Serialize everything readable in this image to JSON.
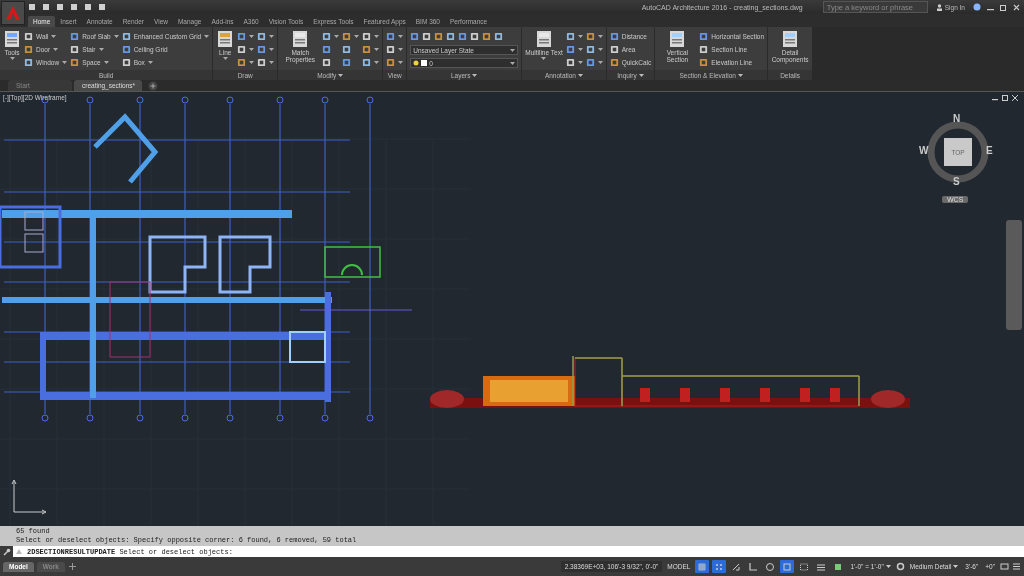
{
  "title_bar": {
    "title": "AutoCAD Architecture 2016 - creating_sections.dwg",
    "search_placeholder": "Type a keyword or phrase",
    "sign_in": "Sign In"
  },
  "ribbon_tabs": [
    {
      "label": "Home",
      "selected": true
    },
    {
      "label": "Insert",
      "selected": false
    },
    {
      "label": "Annotate",
      "selected": false
    },
    {
      "label": "Render",
      "selected": false
    },
    {
      "label": "View",
      "selected": false
    },
    {
      "label": "Manage",
      "selected": false
    },
    {
      "label": "Add-ins",
      "selected": false
    },
    {
      "label": "A360",
      "selected": false
    },
    {
      "label": "Vision Tools",
      "selected": false
    },
    {
      "label": "Express Tools",
      "selected": false
    },
    {
      "label": "Featured Apps",
      "selected": false
    },
    {
      "label": "BIM 360",
      "selected": false
    },
    {
      "label": "Performance",
      "selected": false
    }
  ],
  "ribbon_panels": [
    {
      "title": "Build",
      "menu": false,
      "columns": [
        [
          {
            "kind": "large",
            "label": "Tools",
            "menu": true
          }
        ],
        [
          {
            "kind": "small",
            "label": "Wall",
            "menu": true
          },
          {
            "kind": "small",
            "label": "Door",
            "menu": true
          },
          {
            "kind": "small",
            "label": "Window",
            "menu": true
          }
        ],
        [
          {
            "kind": "small",
            "label": "Roof Slab",
            "menu": true
          },
          {
            "kind": "small",
            "label": "Stair",
            "menu": true
          },
          {
            "kind": "small",
            "label": "Space",
            "menu": true
          }
        ],
        [
          {
            "kind": "small",
            "label": "Enhanced Custom Grid",
            "menu": true
          },
          {
            "kind": "small",
            "label": "Ceiling Grid",
            "menu": false
          },
          {
            "kind": "small",
            "label": "Box",
            "menu": true
          }
        ]
      ]
    },
    {
      "title": "Draw",
      "menu": false,
      "columns": [
        [
          {
            "kind": "large",
            "label": "Line",
            "menu": true
          }
        ],
        [
          {
            "kind": "icon",
            "menu": true
          },
          {
            "kind": "icon",
            "menu": true
          },
          {
            "kind": "icon",
            "menu": true
          }
        ],
        [
          {
            "kind": "icon",
            "menu": true
          },
          {
            "kind": "icon",
            "menu": true
          },
          {
            "kind": "icon",
            "menu": true
          }
        ]
      ]
    },
    {
      "title": "Modify",
      "menu": true,
      "columns": [
        [
          {
            "kind": "large",
            "label": "Match Properties",
            "menu": false
          }
        ],
        [
          {
            "kind": "icon",
            "menu": true
          },
          {
            "kind": "icon",
            "menu": false
          },
          {
            "kind": "icon",
            "menu": false
          }
        ],
        [
          {
            "kind": "icon",
            "menu": true
          },
          {
            "kind": "icon",
            "menu": false
          },
          {
            "kind": "icon",
            "menu": false
          }
        ],
        [
          {
            "kind": "icon",
            "menu": true
          },
          {
            "kind": "icon",
            "menu": true
          },
          {
            "kind": "icon",
            "menu": true
          }
        ]
      ]
    },
    {
      "title": "View",
      "menu": false,
      "columns": [
        [
          {
            "kind": "icon",
            "menu": true
          },
          {
            "kind": "icon",
            "menu": true
          },
          {
            "kind": "icon",
            "menu": true
          }
        ]
      ]
    },
    {
      "title": "Layers",
      "menu": true,
      "columns": [
        [
          {
            "kind": "iconrow"
          },
          {
            "kind": "dropdown",
            "label": "Unsaved Layer State"
          },
          {
            "kind": "layer",
            "label": "0"
          }
        ]
      ]
    },
    {
      "title": "Annotation",
      "menu": true,
      "columns": [
        [
          {
            "kind": "large",
            "label": "Multiline Text",
            "menu": true
          }
        ],
        [
          {
            "kind": "icon",
            "menu": true
          },
          {
            "kind": "icon",
            "menu": true
          },
          {
            "kind": "icon",
            "menu": true
          }
        ],
        [
          {
            "kind": "icon",
            "menu": true
          },
          {
            "kind": "icon",
            "menu": true
          },
          {
            "kind": "icon",
            "menu": true
          }
        ]
      ]
    },
    {
      "title": "Inquiry",
      "menu": true,
      "columns": [
        [
          {
            "kind": "small",
            "label": "Distance",
            "menu": false
          },
          {
            "kind": "small",
            "label": "Area",
            "menu": false
          },
          {
            "kind": "small",
            "label": "QuickCalc",
            "menu": false
          }
        ]
      ]
    },
    {
      "title": "Section & Elevation",
      "menu": true,
      "columns": [
        [
          {
            "kind": "large",
            "label": "Vertical Section",
            "menu": false
          }
        ],
        [
          {
            "kind": "small",
            "label": "Horizontal Section",
            "menu": false
          },
          {
            "kind": "small",
            "label": "Section Line",
            "menu": false
          },
          {
            "kind": "small",
            "label": "Elevation Line",
            "menu": false
          }
        ]
      ]
    },
    {
      "title": "Details",
      "menu": false,
      "columns": [
        [
          {
            "kind": "large",
            "label": "Detail Components",
            "menu": false
          }
        ]
      ]
    }
  ],
  "doc_tabs": [
    {
      "label": "Start",
      "selected": false
    },
    {
      "label": "creating_sections*",
      "selected": true
    }
  ],
  "viewport": {
    "label": "[-][Top][2D Wireframe]",
    "viewcube": {
      "north": "N",
      "south": "S",
      "east": "E",
      "west": "W",
      "face": "TOP",
      "ucs": "WCS"
    }
  },
  "command_history": [
    "65 found",
    "Select or deselect objects: Specify opposite corner: 6 found, 6 removed, 59 total"
  ],
  "command_line": "**2DSECTIONRESULTUPDATE** Select or deselect objects:",
  "layout_tabs": [
    {
      "label": "Model",
      "selected": true
    },
    {
      "label": "Work",
      "selected": false
    }
  ],
  "status_bar": {
    "coordinates": "2.38369E+03, 106'-3 9/32\", 0'-0\"",
    "space": "MODEL",
    "scale": "1'-0\" = 1'-0\"",
    "detail": "Medium Detail",
    "cut_plane": "3'-6\"",
    "elevation": "+0\"",
    "toggles": [
      {
        "kind": "grid",
        "on": true
      },
      {
        "kind": "snap",
        "on": true
      },
      {
        "kind": "infer",
        "on": false
      },
      {
        "kind": "ortho",
        "on": false
      },
      {
        "kind": "polar",
        "on": false
      },
      {
        "kind": "osnap",
        "on": true
      },
      {
        "kind": "object",
        "on": false
      },
      {
        "kind": "lineweight",
        "on": false
      },
      {
        "kind": "transparency",
        "on": false
      }
    ]
  }
}
